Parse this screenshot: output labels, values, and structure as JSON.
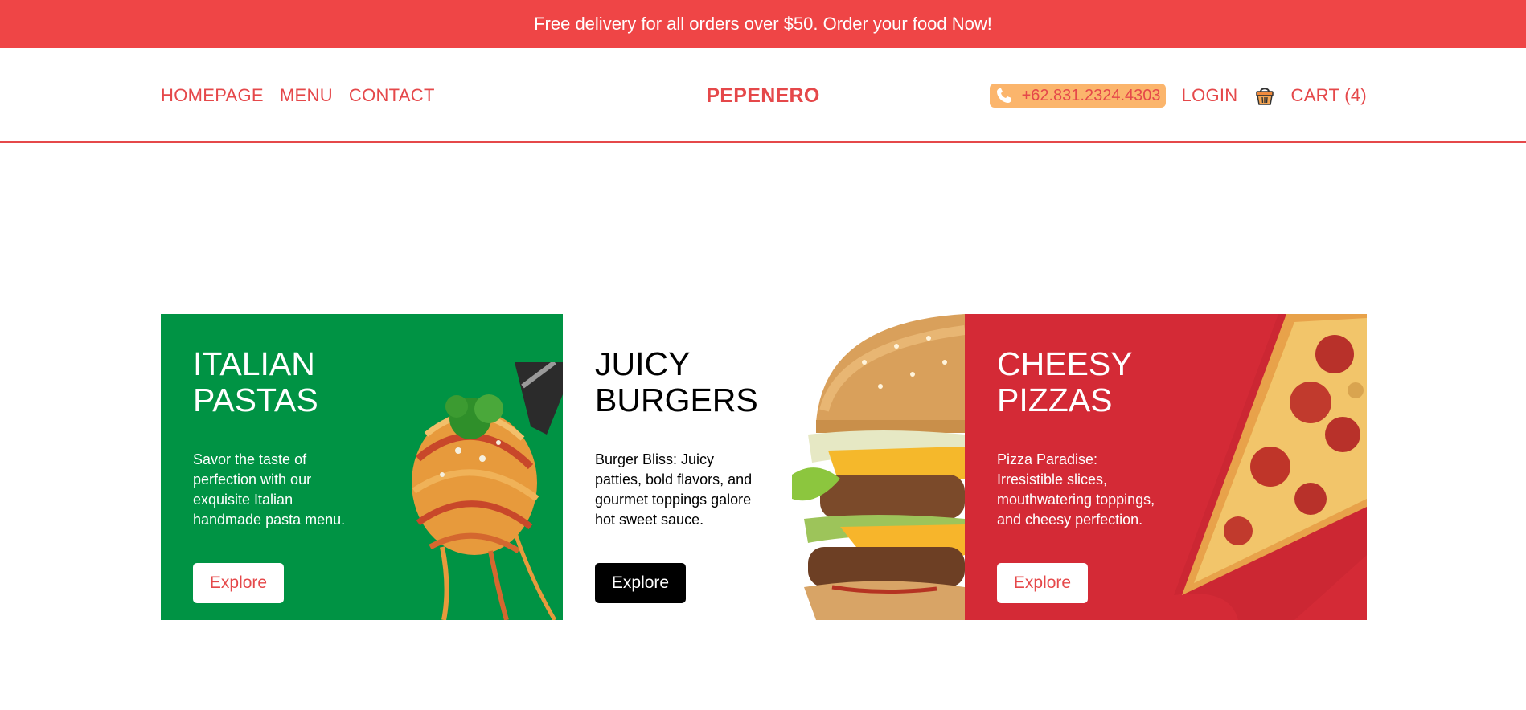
{
  "promo": {
    "text": "Free delivery for all orders over $50. Order your food Now!"
  },
  "nav": {
    "links": [
      "HOMEPAGE",
      "MENU",
      "CONTACT"
    ],
    "brand": "PEPENERO",
    "phone": "+62.831.2324.4303",
    "login": "LOGIN",
    "cart": "CART (4)"
  },
  "icons": {
    "phone": "phone-icon",
    "cart": "basket-icon"
  },
  "colors": {
    "accent": "#ef4546",
    "phone_pill": "#fbb56c",
    "pasta_bg": "#009344",
    "burger_bg": "#ffffff",
    "pizza_bg": "#d42a36"
  },
  "cards": [
    {
      "title": "ITALIAN\nPASTAS",
      "description": "Savor the taste of perfection with our exquisite Italian handmade pasta menu.",
      "button": "Explore"
    },
    {
      "title": "JUICY\nBURGERS",
      "description": "Burger Bliss: Juicy patties, bold flavors, and gourmet toppings galore hot sweet sauce.",
      "button": "Explore"
    },
    {
      "title": "CHEESY\nPIZZAS",
      "description": "Pizza Paradise: Irresistible slices, mouthwatering toppings, and cheesy perfection.",
      "button": "Explore"
    }
  ]
}
